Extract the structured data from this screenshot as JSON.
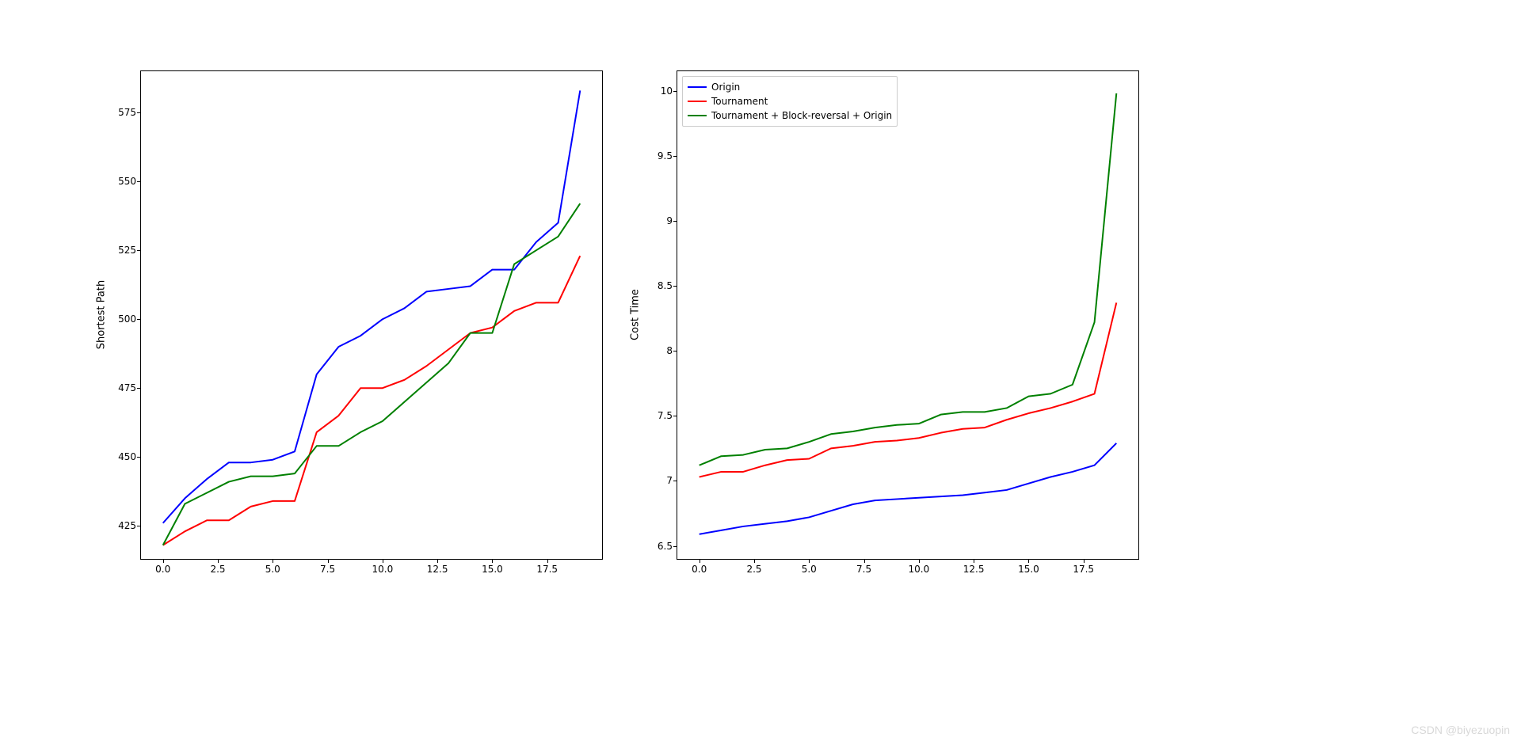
{
  "watermark": "CSDN @biyezuopin",
  "left": {
    "ylabel": "Shortest Path",
    "x_ticks": [
      0.0,
      2.5,
      5.0,
      7.5,
      10.0,
      12.5,
      15.0,
      17.5
    ],
    "y_ticks": [
      425,
      450,
      475,
      500,
      525,
      550,
      575
    ],
    "xlim": [
      -1,
      20
    ],
    "ylim": [
      413,
      590
    ]
  },
  "right": {
    "ylabel": "Cost Time",
    "x_ticks": [
      0.0,
      2.5,
      5.0,
      7.5,
      10.0,
      12.5,
      15.0,
      17.5
    ],
    "y_ticks": [
      6.5,
      7.0,
      7.5,
      8.0,
      8.5,
      9.0,
      9.5,
      10.0
    ],
    "xlim": [
      -1,
      20
    ],
    "ylim": [
      6.4,
      10.15
    ]
  },
  "legend": {
    "items": [
      {
        "label": "Origin",
        "color": "#0000ff"
      },
      {
        "label": "Tournament",
        "color": "#ff0000"
      },
      {
        "label": "Tournament + Block-reversal + Origin",
        "color": "#008000"
      }
    ]
  },
  "colors": {
    "origin": "#0000ff",
    "tournament": "#ff0000",
    "tbro": "#008000"
  },
  "chart_data": [
    {
      "type": "line",
      "title": "",
      "xlabel": "",
      "ylabel": "Shortest Path",
      "xlim": [
        -1,
        20
      ],
      "ylim": [
        413,
        590
      ],
      "x": [
        0,
        1,
        2,
        3,
        4,
        5,
        6,
        7,
        8,
        9,
        10,
        11,
        12,
        13,
        14,
        15,
        16,
        17,
        18,
        19
      ],
      "series": [
        {
          "name": "Origin",
          "color": "#0000ff",
          "values": [
            426,
            435,
            442,
            448,
            448,
            449,
            452,
            480,
            490,
            494,
            500,
            504,
            510,
            511,
            512,
            518,
            518,
            528,
            535,
            583
          ]
        },
        {
          "name": "Tournament",
          "color": "#ff0000",
          "values": [
            418,
            423,
            427,
            427,
            432,
            434,
            434,
            459,
            465,
            475,
            475,
            478,
            483,
            489,
            495,
            497,
            503,
            506,
            506,
            523
          ]
        },
        {
          "name": "Tournament + Block-reversal + Origin",
          "color": "#008000",
          "values": [
            418,
            433,
            437,
            441,
            443,
            443,
            444,
            454,
            454,
            459,
            463,
            470,
            477,
            484,
            495,
            495,
            520,
            525,
            530,
            542
          ]
        }
      ],
      "legend_position": "none"
    },
    {
      "type": "line",
      "title": "",
      "xlabel": "",
      "ylabel": "Cost Time",
      "xlim": [
        -1,
        20
      ],
      "ylim": [
        6.4,
        10.15
      ],
      "x": [
        0,
        1,
        2,
        3,
        4,
        5,
        6,
        7,
        8,
        9,
        10,
        11,
        12,
        13,
        14,
        15,
        16,
        17,
        18,
        19
      ],
      "series": [
        {
          "name": "Origin",
          "color": "#0000ff",
          "values": [
            6.59,
            6.62,
            6.65,
            6.67,
            6.69,
            6.72,
            6.77,
            6.82,
            6.85,
            6.86,
            6.87,
            6.88,
            6.89,
            6.91,
            6.93,
            6.98,
            7.03,
            7.07,
            7.12,
            7.29
          ]
        },
        {
          "name": "Tournament",
          "color": "#ff0000",
          "values": [
            7.03,
            7.07,
            7.07,
            7.12,
            7.16,
            7.17,
            7.25,
            7.27,
            7.3,
            7.31,
            7.33,
            7.37,
            7.4,
            7.41,
            7.47,
            7.52,
            7.56,
            7.61,
            7.67,
            8.37
          ]
        },
        {
          "name": "Tournament + Block-reversal + Origin",
          "color": "#008000",
          "values": [
            7.12,
            7.19,
            7.2,
            7.24,
            7.25,
            7.3,
            7.36,
            7.38,
            7.41,
            7.43,
            7.44,
            7.51,
            7.53,
            7.53,
            7.56,
            7.65,
            7.67,
            7.74,
            8.22,
            9.98
          ]
        }
      ],
      "legend_position": "upper-left"
    }
  ]
}
